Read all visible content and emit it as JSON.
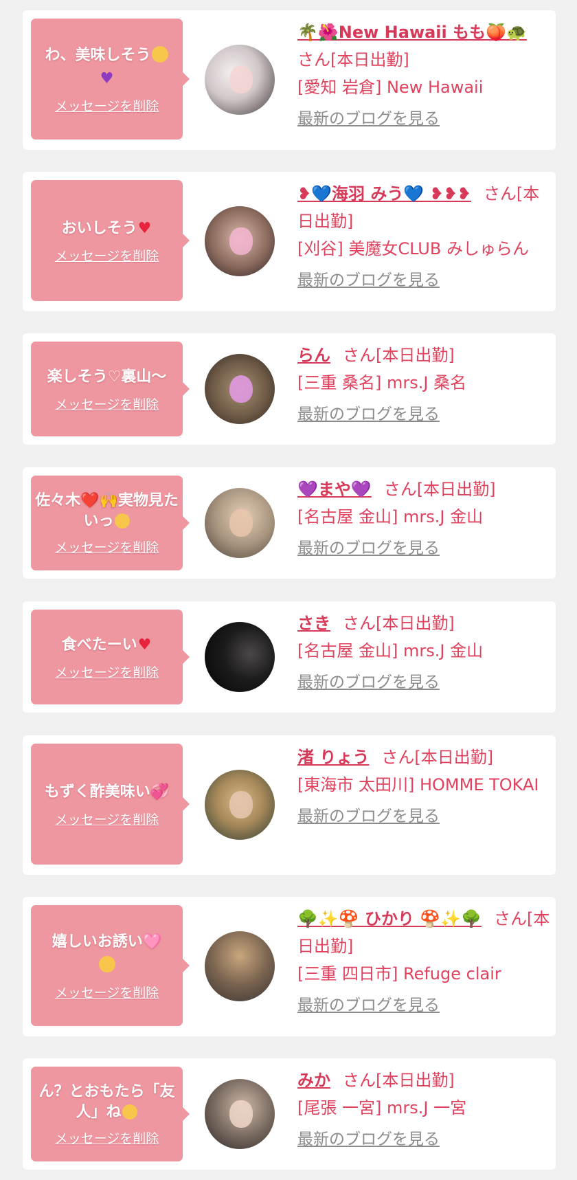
{
  "colors": {
    "page_bg": "#f0f0f0",
    "card_bg": "#ffffff",
    "bubble_bg": "#ee97a0",
    "name_color": "#d63a58",
    "info_color": "#e0425e",
    "blog_link_color": "#8b8b8b"
  },
  "entries": [
    {
      "message": "わ、美味しそう",
      "message_icons": [
        "relieved-face-icon",
        "purple-heart-icon"
      ],
      "delete_label": "メッセージを削除",
      "name": "🌴🌺New Hawaii もも🍑🐢",
      "suffix": "さん[本日出勤]",
      "shop": "[愛知 岩倉] New Hawaii",
      "blog_label": "最新のブログを見る"
    },
    {
      "message": "おいしそう",
      "message_icons": [
        "red-heart-icon"
      ],
      "delete_label": "メッセージを削除",
      "name": "❥💙海羽 みう💙 ❥❥❥",
      "suffix": "さん[本日出勤]",
      "shop": "[刈谷] 美魔女CLUB みしゅらん",
      "blog_label": "最新のブログを見る"
    },
    {
      "message": "楽しそう♡裏山〜",
      "message_icons": [],
      "delete_label": "メッセージを削除",
      "name": "らん",
      "suffix": "さん[本日出勤]",
      "shop": "[三重 桑名] mrs.J 桑名",
      "blog_label": "最新のブログを見る"
    },
    {
      "message": "佐々木❤️🙌実物見たいっ",
      "message_icons": [
        "pleading-face-icon"
      ],
      "delete_label": "メッセージを削除",
      "name": "💜まや💜",
      "suffix": "さん[本日出勤]",
      "shop": "[名古屋 金山] mrs.J 金山",
      "blog_label": "最新のブログを見る"
    },
    {
      "message": "食べたーい",
      "message_icons": [
        "red-heart-icon"
      ],
      "delete_label": "メッセージを削除",
      "name": "さき",
      "suffix": "さん[本日出勤]",
      "shop": "[名古屋 金山] mrs.J 金山",
      "blog_label": "最新のブログを見る"
    },
    {
      "message": "もずく酢美味い💞",
      "message_icons": [
        "two-hearts-icon"
      ],
      "delete_label": "メッセージを削除",
      "name": "渚 りょう",
      "suffix": "さん[本日出勤]",
      "shop": "[東海市 太田川] HOMME TOKAI",
      "blog_label": "最新のブログを見る"
    },
    {
      "message": "嬉しいお誘い🩷",
      "message_icons": [
        "smiling-face-icon"
      ],
      "delete_label": "メッセージを削除",
      "name": "🌳✨🍄 ひかり 🍄✨🌳",
      "suffix": "さん[本日出勤]",
      "shop": "[三重 四日市] Refuge clair",
      "blog_label": "最新のブログを見る"
    },
    {
      "message": "ん？とおもたら「友人」ね",
      "message_icons": [
        "hand-over-mouth-face-icon"
      ],
      "delete_label": "メッセージを削除",
      "name": "みか",
      "suffix": "さん[本日出勤]",
      "shop": "[尾張 一宮] mrs.J 一宮",
      "blog_label": "最新のブログを見る"
    }
  ]
}
